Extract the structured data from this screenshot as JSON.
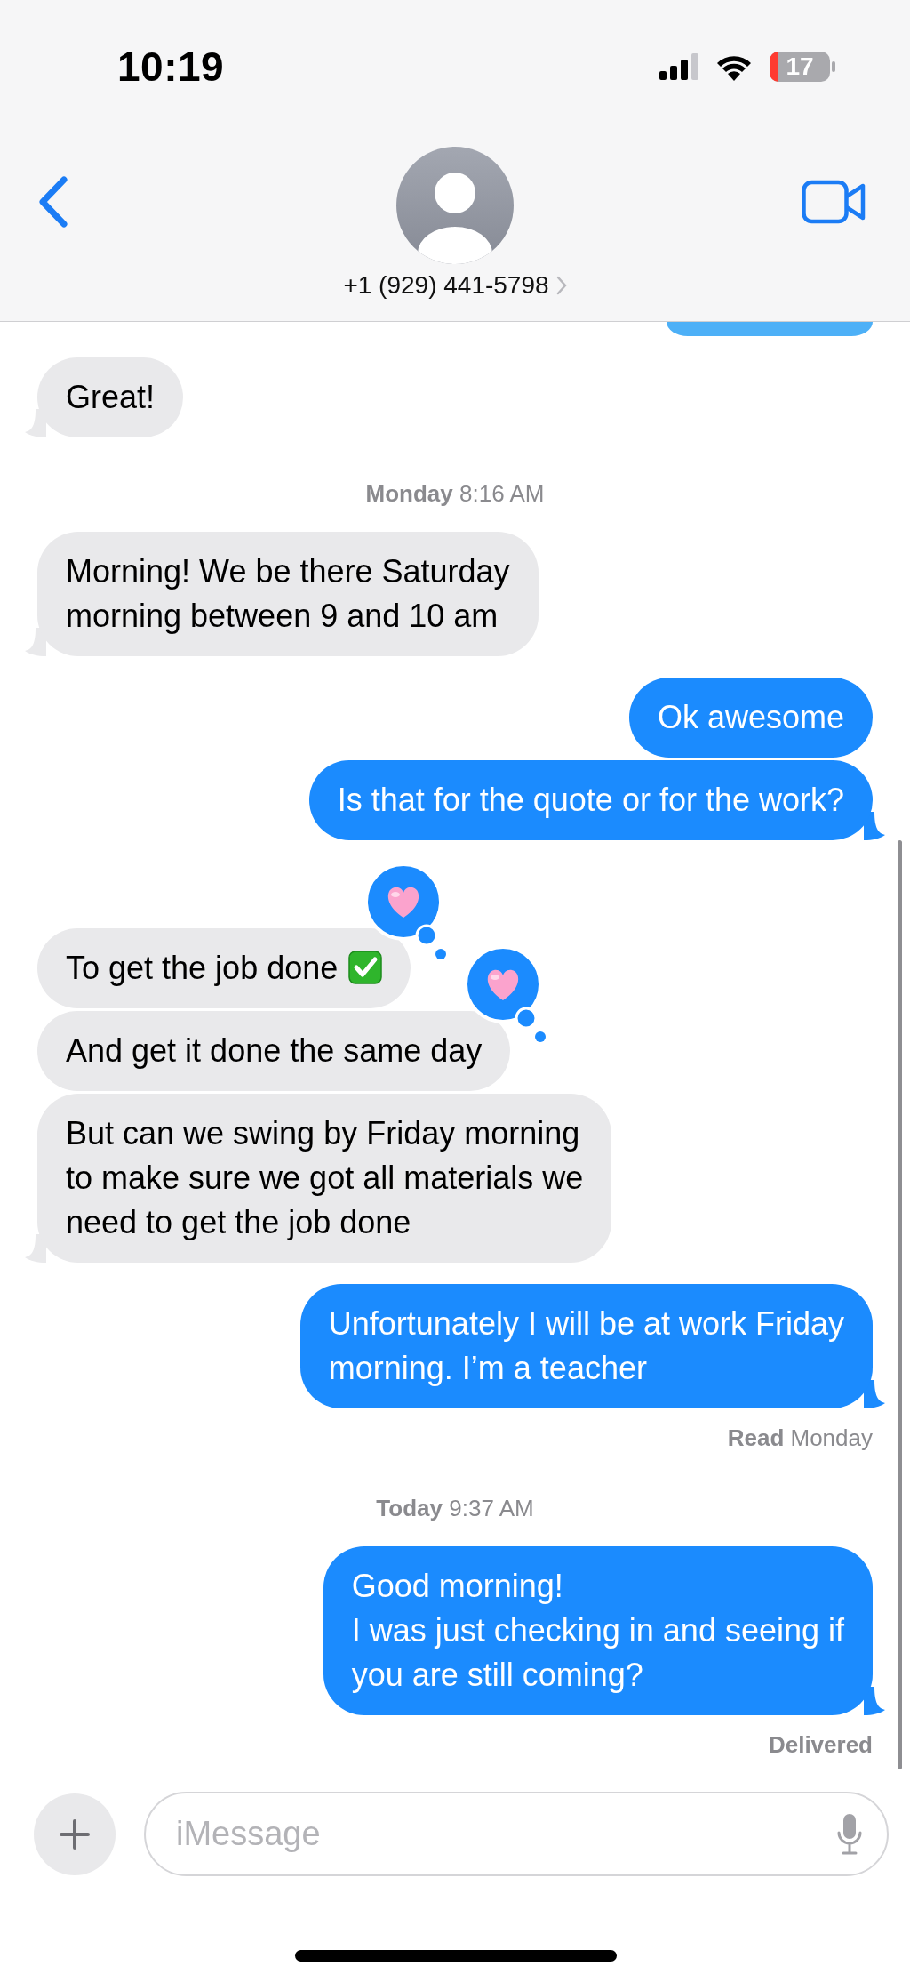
{
  "status_bar": {
    "time": "10:19",
    "battery": "17"
  },
  "header": {
    "contact": "+1 (929) 441-5798"
  },
  "messages": [
    {
      "kind": "incoming",
      "text": "Great!",
      "tail": true,
      "tapback": false,
      "check_icon": false
    },
    {
      "kind": "timestamp",
      "day": "Monday",
      "time": "8:16 AM"
    },
    {
      "kind": "incoming",
      "text": "Morning! We be there Saturday\nmorning between 9 and 10 am",
      "tail": true,
      "tapback": false,
      "check_icon": false
    },
    {
      "kind": "outgoing",
      "text": "Ok awesome",
      "tail": false
    },
    {
      "kind": "outgoing",
      "text": "Is that for the quote or for the work?",
      "tail": true
    },
    {
      "kind": "incoming",
      "text": "To get the job done",
      "tail": false,
      "tapback": true,
      "check_icon": true
    },
    {
      "kind": "incoming",
      "text": "And get it done the same day",
      "tail": false,
      "tapback": true,
      "check_icon": false
    },
    {
      "kind": "incoming",
      "text": "But can we swing by Friday morning\nto make sure we got all materials we\nneed to get the job done",
      "tail": true,
      "tapback": false,
      "check_icon": false
    },
    {
      "kind": "outgoing",
      "text": "Unfortunately I will be at work Friday\nmorning. I’m a teacher",
      "tail": true
    },
    {
      "kind": "status",
      "label": "Read",
      "detail": "Monday"
    },
    {
      "kind": "timestamp",
      "day": "Today",
      "time": "9:37 AM"
    },
    {
      "kind": "outgoing",
      "text": "Good morning!\nI was just checking in and seeing if\nyou are still coming?",
      "tail": true
    },
    {
      "kind": "status",
      "label": "Delivered"
    }
  ],
  "composer": {
    "placeholder": "iMessage"
  }
}
